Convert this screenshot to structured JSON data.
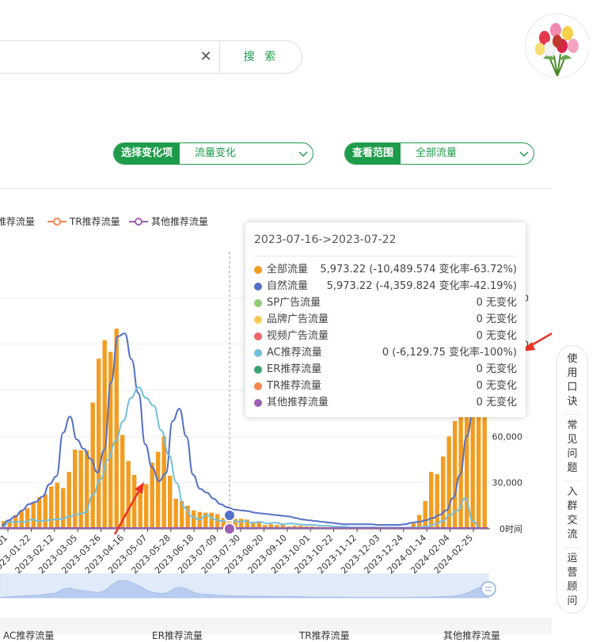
{
  "search": {
    "clear_icon": "close-icon",
    "button_label": "搜 索"
  },
  "avatar": {
    "icon": "flower-bouquet-icon"
  },
  "selects": {
    "change": {
      "label": "选择变化项",
      "value": "流量变化"
    },
    "scope": {
      "label": "查看范围",
      "value": "全部流量"
    }
  },
  "colors": {
    "brand_green": "#1e9c4a",
    "total": "#f39c1f",
    "natural": "#5470c6",
    "sp": "#91cc75",
    "brand_ad": "#fac858",
    "video": "#ee6666",
    "ac": "#73c0de",
    "er": "#3ba272",
    "tr": "#fc8452",
    "other": "#9a60b4"
  },
  "chart_data": {
    "type": "bar",
    "legend": [
      {
        "name": "推荐流量",
        "color": "#3ba272"
      },
      {
        "name": "TR推荐流量",
        "color": "#fc8452"
      },
      {
        "name": "其他推荐流量",
        "color": "#9a60b4"
      }
    ],
    "x_tick_labels": [
      "01",
      "2023-01-22",
      "2023-02-12",
      "2023-03-05",
      "2023-03-26",
      "2023-04-16",
      "2023-05-07",
      "2023-05-28",
      "2023-06-18",
      "2023-07-09",
      "2023-07-30",
      "2023-08-20",
      "2023-09-10",
      "2023-10-01",
      "2023-10-22",
      "2023-11-12",
      "2023-12-03",
      "2023-12-24",
      "2024-01-14",
      "2024-02-04",
      "2024-02-25"
    ],
    "y_right_ticks": [
      "0时间",
      "30,000",
      "60,000"
    ],
    "y_right_partial": [
      "0",
      "0"
    ],
    "ylim": [
      0,
      180000
    ],
    "total_bars": [
      5000,
      6000,
      9000,
      11500,
      13500,
      17500,
      20500,
      22500,
      27500,
      30000,
      26500,
      37000,
      51500,
      51000,
      51000,
      82000,
      110500,
      122500,
      115000,
      130000,
      61000,
      44000,
      35000,
      24500,
      29000,
      43000,
      50000,
      60000,
      34500,
      19500,
      18000,
      15000,
      12000,
      11000,
      10500,
      10500,
      9500,
      7000,
      7000,
      6500,
      6500,
      6000,
      4500,
      4500,
      2500,
      3000,
      2500,
      2500,
      1500,
      2000,
      2000,
      1500,
      1500,
      1200,
      1200,
      1200,
      1200,
      1200,
      1000,
      1000,
      1000,
      800,
      800,
      800,
      800,
      800,
      700,
      700,
      700,
      3500,
      9000,
      18000,
      37000,
      35500,
      47000,
      60000,
      70000,
      80000,
      90000,
      100000,
      110000,
      120000
    ],
    "natural_line": [
      2000,
      5500,
      8000,
      12000,
      16000,
      17500,
      21000,
      29000,
      34000,
      62500,
      73000,
      58000,
      52000,
      45500,
      36500,
      51000,
      95000,
      125000,
      127000,
      110000,
      88000,
      55000,
      40000,
      31000,
      36000,
      70000,
      78000,
      60000,
      35000,
      26000,
      23500,
      19500,
      16000,
      14000,
      12500,
      12000,
      11500,
      10500,
      10000,
      9500,
      9000,
      8500,
      8000,
      7000,
      6000,
      5500,
      5000,
      4500,
      4000,
      3500,
      3000,
      3000,
      3000,
      3000,
      3000,
      2500,
      2500,
      2500,
      2500,
      3000,
      4000,
      4500,
      5500,
      7000,
      9000,
      12000,
      20000,
      35000,
      60000,
      80000,
      100000
    ],
    "ac_line": [
      0,
      4500,
      4500,
      4500,
      6000,
      5000,
      5500,
      6000,
      6500,
      8000,
      9500,
      10500,
      22000,
      32000,
      45000,
      57000,
      70000,
      85000,
      92000,
      85000,
      80000,
      64000,
      48000,
      30000,
      14000,
      8000,
      6000,
      9000,
      6000,
      5000,
      6500,
      4500,
      5000,
      4000,
      4500,
      3500,
      4000,
      3000,
      3500,
      3000,
      2500,
      2500,
      2000,
      2000,
      1500,
      1500,
      1000,
      1000,
      1000,
      1000,
      800,
      800,
      800,
      800,
      800,
      1000,
      1500,
      3000,
      5000,
      9000,
      12000,
      20000,
      5000,
      0
    ],
    "highlight_date_range": "2023-07-16->2023-07-22"
  },
  "tooltip": {
    "title": "2023-07-16->2023-07-22",
    "rows": [
      {
        "name": "全部流量",
        "value": "5,973.22 (-10,489.574 变化率-63.72%)",
        "color": "#f39c1f"
      },
      {
        "name": "自然流量",
        "value": "5,973.22 (-4,359.824 变化率-42.19%)",
        "color": "#5470c6"
      },
      {
        "name": "SP广告流量",
        "value": "0 无变化",
        "color": "#91cc75"
      },
      {
        "name": "品牌广告流量",
        "value": "0 无变化",
        "color": "#fac858"
      },
      {
        "name": "视频广告流量",
        "value": "0 无变化",
        "color": "#ee6666"
      },
      {
        "name": "AC推荐流量",
        "value": "0 (-6,129.75 变化率-100%)",
        "color": "#73c0de"
      },
      {
        "name": "ER推荐流量",
        "value": "0 无变化",
        "color": "#3ba272"
      },
      {
        "name": "TR推荐流量",
        "value": "0 无变化",
        "color": "#fc8452"
      },
      {
        "name": "其他推荐流量",
        "value": "0 无变化",
        "color": "#9a60b4"
      }
    ]
  },
  "side_float": [
    {
      "label": "使用口诀",
      "lines": [
        "使",
        "用",
        "口",
        "诀"
      ]
    },
    {
      "label": "常见问题",
      "lines": [
        "常",
        "见",
        "问",
        "题"
      ]
    },
    {
      "label": "入群交流",
      "lines": [
        "入",
        "群",
        "交",
        "流"
      ]
    },
    {
      "label": "运营顾问",
      "lines": [
        "运",
        "营",
        "顾",
        "问"
      ]
    }
  ],
  "bottom_labels": [
    "AC推荐流量",
    "ER推荐流量",
    "TR推荐流量",
    "其他推荐流量"
  ]
}
